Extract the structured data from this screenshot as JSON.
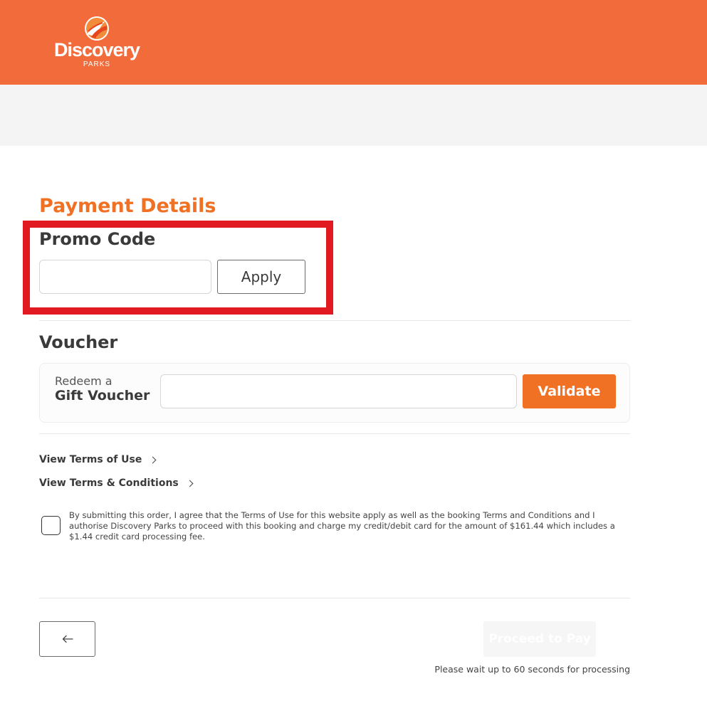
{
  "colors": {
    "brand": "#f26b3a",
    "accent": "#f07024",
    "highlight": "#e11a22"
  },
  "header": {
    "logo_word": "Discovery",
    "logo_sub": "PARKS",
    "logo_icon": "discovery-parks-sun-icon"
  },
  "main": {
    "title": "Payment Details",
    "promo": {
      "heading": "Promo Code",
      "input_value": "",
      "input_placeholder": "",
      "apply_label": "Apply"
    },
    "voucher": {
      "heading": "Voucher",
      "redeem_label": "Redeem a",
      "gift_label": "Gift Voucher",
      "input_value": "",
      "input_placeholder": "",
      "validate_label": "Validate"
    },
    "links": {
      "terms_of_use": "View Terms of Use",
      "terms_conditions": "View Terms & Conditions",
      "icon": "chevron-right-icon"
    },
    "agreement": {
      "checked": false,
      "text": "By submitting this order, I agree that the Terms of Use for this website apply as well as the booking Terms and Conditions and I authorise Discovery Parks to proceed with this booking and charge my credit/debit card for the amount of $161.44 which includes a $1.44 credit card processing fee."
    }
  },
  "footer": {
    "back_icon": "arrow-left-icon",
    "proceed_label": "Proceed to Pay",
    "processing_note": "Please wait up to 60 seconds for processing"
  }
}
